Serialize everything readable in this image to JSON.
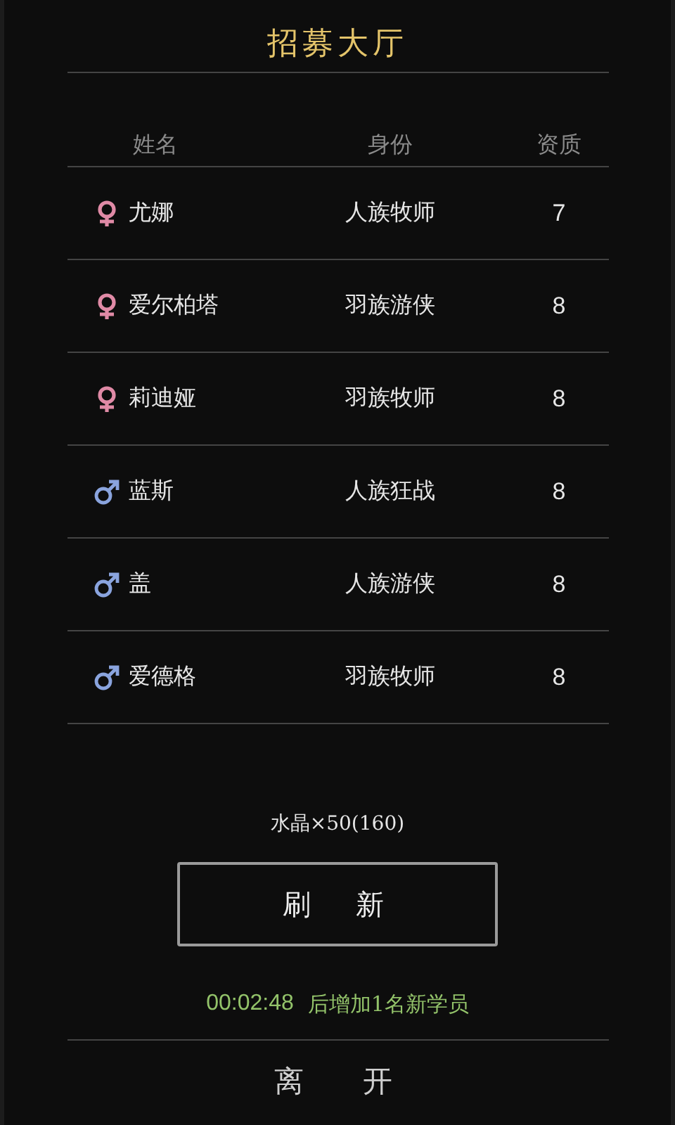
{
  "title": "招募大厅",
  "table": {
    "columns": [
      "姓名",
      "身份",
      "资质"
    ],
    "rows": [
      {
        "kind": "female",
        "name": "尤娜",
        "role": "人族牧师",
        "aptitude": "7"
      },
      {
        "kind": "female",
        "name": "爱尔柏塔",
        "role": "羽族游侠",
        "aptitude": "8"
      },
      {
        "kind": "female",
        "name": "莉迪娅",
        "role": "羽族牧师",
        "aptitude": "8"
      },
      {
        "kind": "male",
        "name": "蓝斯",
        "role": "人族狂战",
        "aptitude": "8"
      },
      {
        "kind": "male",
        "name": "盖",
        "role": "人族游侠",
        "aptitude": "8"
      },
      {
        "kind": "male",
        "name": "爱德格",
        "role": "羽族牧师",
        "aptitude": "8"
      }
    ]
  },
  "cost": "水晶×50(160)",
  "refresh_button": "刷新",
  "timer": "00:02:48",
  "timer_note": "后增加1名新学员",
  "leave_button": "离开"
}
